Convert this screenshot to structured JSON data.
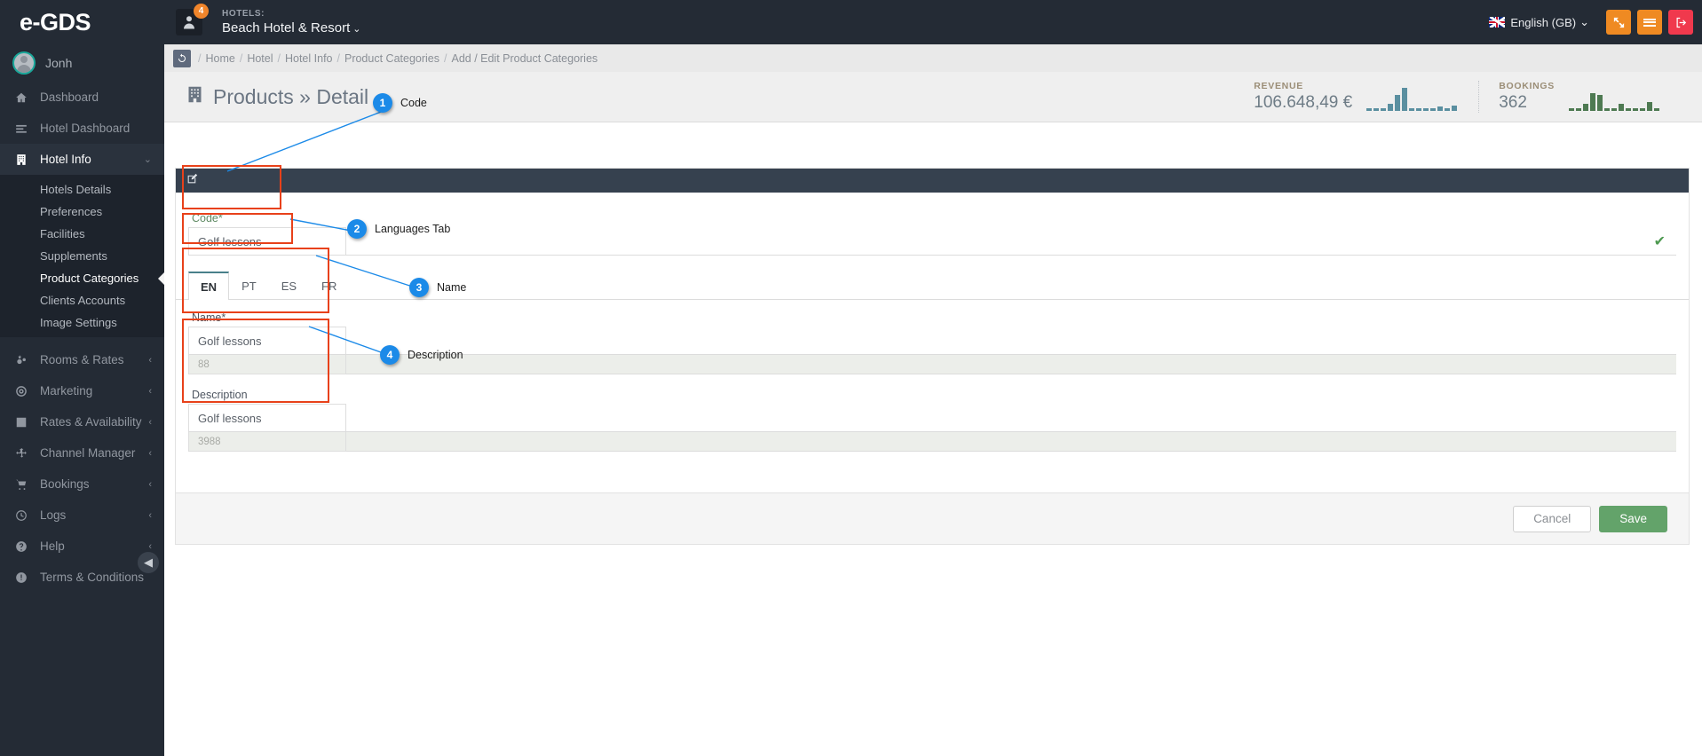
{
  "topbar": {
    "brand": "e-GDS",
    "notification_count": "4",
    "hotels_label": "HOTELS:",
    "hotel_name": "Beach Hotel & Resort",
    "hotel_caret": "⌄",
    "language": "English (GB)",
    "language_caret": "⌄",
    "expand_icon": "expand-arrows-icon",
    "menu_icon": "hamburger-icon",
    "logout_icon": "logout-icon"
  },
  "sidebar": {
    "profile_name": "Jonh",
    "collapse_icon": "◀",
    "items": [
      {
        "label": "Dashboard",
        "icon": "home-icon",
        "active": false,
        "chevron": ""
      },
      {
        "label": "Hotel Dashboard",
        "icon": "list-icon",
        "active": false,
        "chevron": ""
      },
      {
        "label": "Hotel Info",
        "icon": "building-icon",
        "active": true,
        "chevron": "⌄"
      },
      {
        "label": "Rooms & Rates",
        "icon": "gears-icon",
        "active": false,
        "chevron": "‹"
      },
      {
        "label": "Marketing",
        "icon": "target-icon",
        "active": false,
        "chevron": "‹"
      },
      {
        "label": "Rates & Availability",
        "icon": "bar-chart-icon",
        "active": false,
        "chevron": "‹"
      },
      {
        "label": "Channel Manager",
        "icon": "arrows-icon",
        "active": false,
        "chevron": "‹"
      },
      {
        "label": "Bookings",
        "icon": "cart-icon",
        "active": false,
        "chevron": "‹"
      },
      {
        "label": "Logs",
        "icon": "clock-icon",
        "active": false,
        "chevron": "‹"
      },
      {
        "label": "Help",
        "icon": "question-icon",
        "active": false,
        "chevron": "‹"
      },
      {
        "label": "Terms & Conditions",
        "icon": "info-icon",
        "active": false,
        "chevron": ""
      }
    ],
    "submenu": [
      {
        "label": "Hotels Details",
        "selected": false
      },
      {
        "label": "Preferences",
        "selected": false
      },
      {
        "label": "Facilities",
        "selected": false
      },
      {
        "label": "Supplements",
        "selected": false
      },
      {
        "label": "Product Categories",
        "selected": true
      },
      {
        "label": "Clients Accounts",
        "selected": false
      },
      {
        "label": "Image Settings",
        "selected": false
      }
    ]
  },
  "breadcrumb": {
    "refresh_icon": "refresh-icon",
    "items": [
      "Home",
      "Hotel",
      "Hotel Info",
      "Product Categories",
      "Add / Edit Product Categories"
    ],
    "separator": "/"
  },
  "page": {
    "title": "Products » Detail",
    "title_icon": "building-icon"
  },
  "stats": [
    {
      "label": "REVENUE",
      "value": "106.648,49 €",
      "color": "#5a8fa0",
      "bars": [
        3,
        3,
        3,
        8,
        18,
        26,
        3,
        3,
        3,
        3,
        5,
        3,
        6
      ]
    },
    {
      "label": "BOOKINGS",
      "value": "362",
      "color": "#4e7a52",
      "bars": [
        3,
        3,
        8,
        20,
        18,
        3,
        3,
        8,
        3,
        3,
        3,
        10,
        3
      ]
    }
  ],
  "form": {
    "panel_icon": "edit-icon",
    "code": {
      "label": "Code*",
      "value": "Golf lessons",
      "valid_icon": "✔"
    },
    "language_tabs": [
      {
        "label": "EN",
        "active": true
      },
      {
        "label": "PT",
        "active": false
      },
      {
        "label": "ES",
        "active": false
      },
      {
        "label": "FR",
        "active": false
      }
    ],
    "name": {
      "label": "Name*",
      "value": "Golf lessons",
      "counter": "88"
    },
    "description": {
      "label": "Description",
      "value": "Golf lessons",
      "counter": "3988"
    },
    "cancel_label": "Cancel",
    "save_label": "Save"
  },
  "annotations": [
    {
      "num": "1",
      "label": "Code"
    },
    {
      "num": "2",
      "label": "Languages Tab"
    },
    {
      "num": "3",
      "label": "Name"
    },
    {
      "num": "4",
      "label": "Description"
    }
  ],
  "colors": {
    "accent_orange": "#ef8a22",
    "accent_red": "#f0394d",
    "sidebar_bg": "#242b35",
    "annotation_box": "#e8411a",
    "annotation_bubble": "#1b8ae8",
    "save_green": "#63a36a",
    "tab_active": "#49808a"
  }
}
